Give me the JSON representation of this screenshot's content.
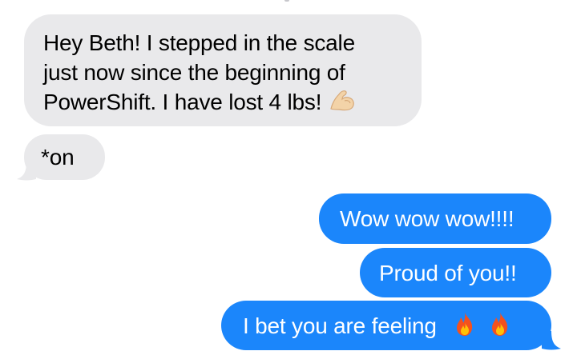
{
  "messages": [
    {
      "direction": "incoming",
      "lines": [
        "Hey Beth! I stepped in the scale",
        "just now since the beginning of",
        "PowerShift. I have lost 4 lbs!"
      ],
      "trailing_emoji": "flexed-biceps-emoji"
    },
    {
      "direction": "incoming",
      "text": "*on"
    },
    {
      "direction": "outgoing",
      "text": "Wow wow wow!!!!"
    },
    {
      "direction": "outgoing",
      "text": "Proud of you!!"
    },
    {
      "direction": "outgoing",
      "text": "I bet you are feeling",
      "trailing_emoji": [
        "fire-emoji",
        "fire-emoji"
      ]
    }
  ],
  "colors": {
    "incoming_bubble": "#e9e9eb",
    "outgoing_bubble": "#1b86fb",
    "incoming_text": "#000000",
    "outgoing_text": "#ffffff"
  }
}
